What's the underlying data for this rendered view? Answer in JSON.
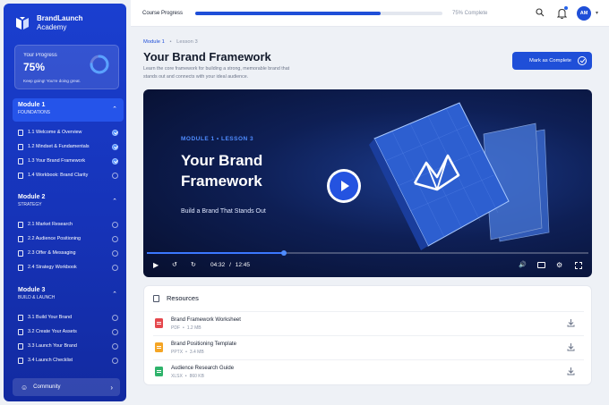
{
  "brand": {
    "name": "BrandLaunch",
    "subtitle": "Academy"
  },
  "progress_card": {
    "label": "Your Progress",
    "value": "75%",
    "message": "Keep going! You're doing great.",
    "fraction": 0.75
  },
  "modules": [
    {
      "title": "Module 1",
      "subtitle": "FOUNDATIONS",
      "active": true,
      "lessons": [
        {
          "label": "1.1 Welcome & Overview",
          "done": true
        },
        {
          "label": "1.2 Mindset & Fundamentals",
          "done": true
        },
        {
          "label": "1.3 Your Brand Framework",
          "done": true
        },
        {
          "label": "1.4 Workbook: Brand Clarity",
          "done": false
        }
      ]
    },
    {
      "title": "Module 2",
      "subtitle": "STRATEGY",
      "active": false,
      "lessons": [
        {
          "label": "2.1 Market Research",
          "done": false
        },
        {
          "label": "2.2 Audience Positioning",
          "done": false
        },
        {
          "label": "2.3 Offer & Messaging",
          "done": false
        },
        {
          "label": "2.4 Strategy Workbook",
          "done": false
        }
      ]
    },
    {
      "title": "Module 3",
      "subtitle": "BUILD & LAUNCH",
      "active": false,
      "lessons": [
        {
          "label": "3.1 Build Your Brand",
          "done": false
        },
        {
          "label": "3.2 Create Your Assets",
          "done": false
        },
        {
          "label": "3.3 Launch Your Brand",
          "done": false
        },
        {
          "label": "3.4 Launch Checklist",
          "done": false
        }
      ]
    }
  ],
  "community": {
    "label": "Community"
  },
  "topbar": {
    "label": "Course Progress",
    "percent_text": "75% Complete",
    "fraction": 0.75,
    "avatar": "AM"
  },
  "breadcrumb": {
    "module": "Module 1",
    "separator": "•",
    "lesson": "Lesson 3"
  },
  "page": {
    "title": "Your Brand Framework",
    "description": "Learn the core framework for building a strong, memorable brand that stands out and connects with your ideal audience.",
    "mark_complete": "Mark as Complete"
  },
  "video": {
    "kicker": "MODULE 1 • LESSON 3",
    "title": "Your Brand Framework",
    "subtitle": "Build a Brand That Stands Out",
    "current_time": "04:32",
    "time_separator": "/",
    "duration": "12:45",
    "played_fraction": 0.31
  },
  "resources": {
    "heading": "Resources",
    "items": [
      {
        "name": "Brand Framework Worksheet",
        "type": "PDF",
        "size": "1.2 MB",
        "dot": "•",
        "color": "#e5484d"
      },
      {
        "name": "Brand Positioning Template",
        "type": "PPTX",
        "size": "3.4 MB",
        "dot": "•",
        "color": "#f5a524"
      },
      {
        "name": "Audience Research Guide",
        "type": "XLSX",
        "size": "860 KB",
        "dot": "•",
        "color": "#2fb36b"
      }
    ]
  },
  "colors": {
    "accent": "#1f4fd8",
    "sidebar": "#1a3fd0"
  }
}
